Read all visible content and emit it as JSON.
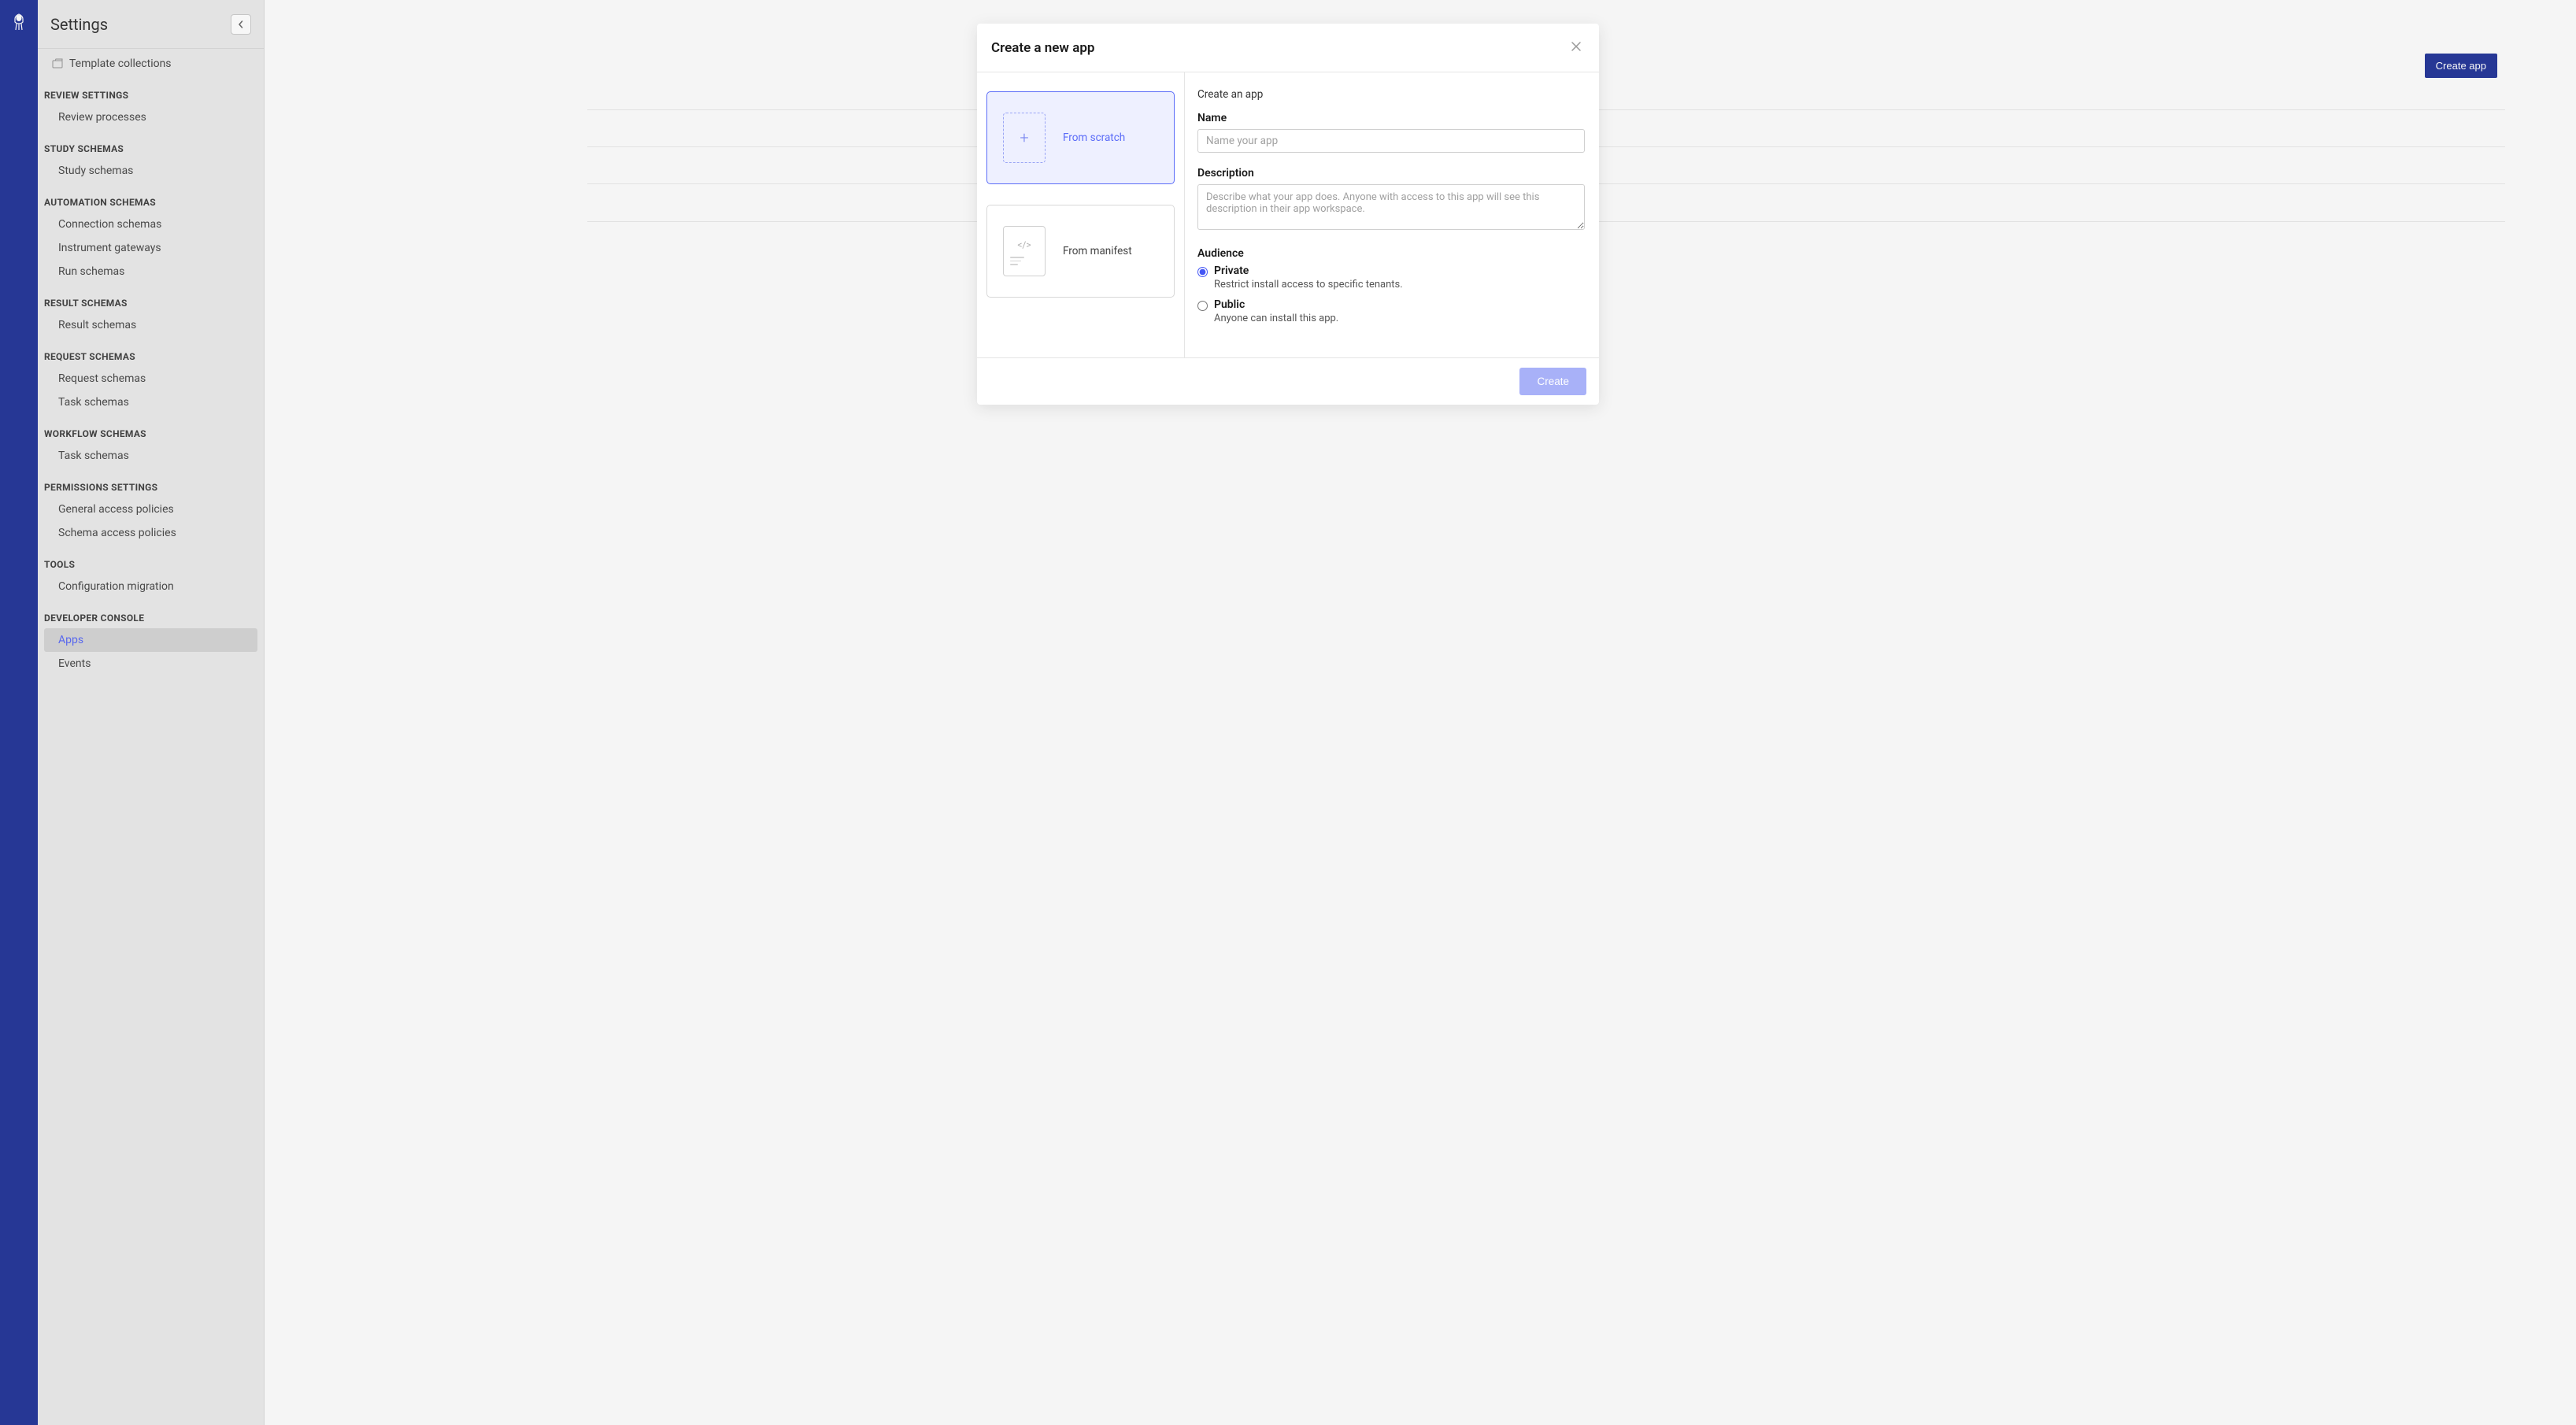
{
  "sidebar": {
    "title": "Settings",
    "template_collections": "Template collections",
    "sections": {
      "review_settings": {
        "header": "REVIEW SETTINGS",
        "items": [
          "Review processes"
        ]
      },
      "study_schemas": {
        "header": "STUDY SCHEMAS",
        "items": [
          "Study schemas"
        ]
      },
      "automation_schemas": {
        "header": "AUTOMATION SCHEMAS",
        "items": [
          "Connection schemas",
          "Instrument gateways",
          "Run schemas"
        ]
      },
      "result_schemas": {
        "header": "RESULT SCHEMAS",
        "items": [
          "Result schemas"
        ]
      },
      "request_schemas": {
        "header": "REQUEST SCHEMAS",
        "items": [
          "Request schemas",
          "Task schemas"
        ]
      },
      "workflow_schemas": {
        "header": "WORKFLOW SCHEMAS",
        "items": [
          "Task schemas"
        ]
      },
      "permissions_settings": {
        "header": "PERMISSIONS SETTINGS",
        "items": [
          "General access policies",
          "Schema access policies"
        ]
      },
      "tools": {
        "header": "TOOLS",
        "items": [
          "Configuration migration"
        ]
      },
      "developer_console": {
        "header": "DEVELOPER CONSOLE",
        "items": [
          "Apps",
          "Events"
        ]
      }
    }
  },
  "main": {
    "create_app_button": "Create app"
  },
  "modal": {
    "title": "Create a new app",
    "options": {
      "scratch": "From scratch",
      "manifest": "From manifest"
    },
    "form": {
      "section_title": "Create an app",
      "name_label": "Name",
      "name_placeholder": "Name your app",
      "description_label": "Description",
      "description_placeholder": "Describe what your app does. Anyone with access to this app will see this description in their app workspace.",
      "audience_label": "Audience",
      "private_label": "Private",
      "private_hint": "Restrict install access to specific tenants.",
      "public_label": "Public",
      "public_hint": "Anyone can install this app."
    },
    "create_button": "Create"
  }
}
